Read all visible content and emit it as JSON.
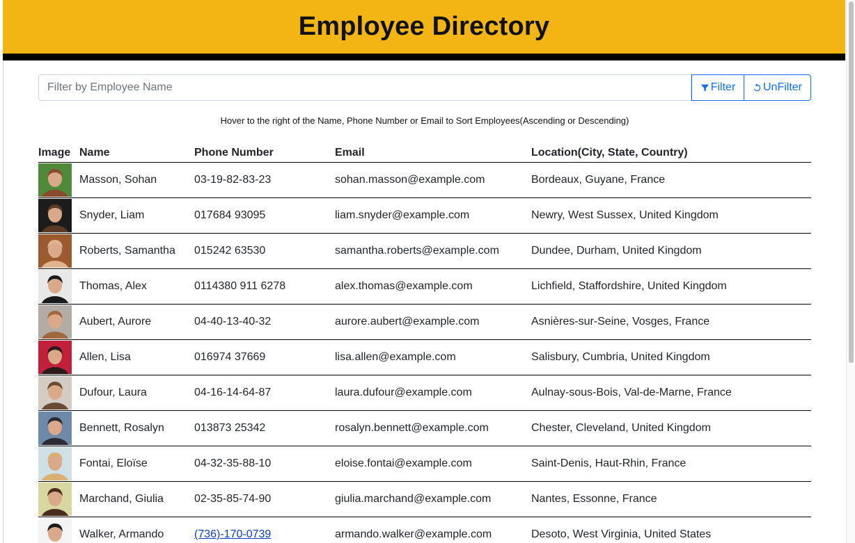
{
  "header": {
    "title": "Employee Directory"
  },
  "search": {
    "placeholder": "Filter by Employee Name",
    "filter_label": "Filter",
    "unfilter_label": "UnFilter"
  },
  "hint": "Hover to the right of the Name, Phone Number or Email to Sort Employees(Ascending or Descending)",
  "table": {
    "columns": [
      "Image",
      "Name",
      "Phone Number",
      "Email",
      "Location(City, State, Country)"
    ],
    "rows": [
      {
        "name": "Masson, Sohan",
        "phone": "03-19-82-83-23",
        "email": "sohan.masson@example.com",
        "location": "Bordeaux, Guyane, France",
        "avatar": [
          "#4e8a3a",
          "#8a4a2e"
        ]
      },
      {
        "name": "Snyder, Liam",
        "phone": "017684 93095",
        "email": "liam.snyder@example.com",
        "location": "Newry, West Sussex, United Kingdom",
        "avatar": [
          "#1c1c1c",
          "#5a3a24"
        ]
      },
      {
        "name": "Roberts, Samantha",
        "phone": "015242 63530",
        "email": "samantha.roberts@example.com",
        "location": "Dundee, Durham, United Kingdom",
        "avatar": [
          "#9c5a2f",
          "#e0b48f"
        ]
      },
      {
        "name": "Thomas, Alex",
        "phone": "0114380 911 6278",
        "email": "alex.thomas@example.com",
        "location": "Lichfield, Staffordshire, United Kingdom",
        "avatar": [
          "#e8e8e8",
          "#1a1a1a"
        ]
      },
      {
        "name": "Aubert, Aurore",
        "phone": "04-40-13-40-32",
        "email": "aurore.aubert@example.com",
        "location": "Asnières-sur-Seine, Vosges, France",
        "avatar": [
          "#b3aca6",
          "#a0683f"
        ]
      },
      {
        "name": "Allen, Lisa",
        "phone": "016974 37669",
        "email": "lisa.allen@example.com",
        "location": "Salisbury, Cumbria, United Kingdom",
        "avatar": [
          "#c21f3a",
          "#2a1a1a"
        ]
      },
      {
        "name": "Dufour, Laura",
        "phone": "04-16-14-64-87",
        "email": "laura.dufour@example.com",
        "location": "Aulnay-sous-Bois, Val-de-Marne, France",
        "avatar": [
          "#d4ccc4",
          "#6b4a33"
        ]
      },
      {
        "name": "Bennett, Rosalyn",
        "phone": "013873 25342",
        "email": "rosalyn.bennett@example.com",
        "location": "Chester, Cleveland, United Kingdom",
        "avatar": [
          "#6f8aa8",
          "#2b2b33"
        ]
      },
      {
        "name": "Fontai, Eloïse",
        "phone": "04-32-35-88-10",
        "email": "eloise.fontai@example.com",
        "location": "Saint-Denis, Haut-Rhin, France",
        "avatar": [
          "#cfe0e6",
          "#d9b070"
        ]
      },
      {
        "name": "Marchand, Giulia",
        "phone": "02-35-85-74-90",
        "email": "giulia.marchand@example.com",
        "location": "Nantes, Essonne, France",
        "avatar": [
          "#d8d7a0",
          "#4a2c1c"
        ]
      },
      {
        "name": "Walker, Armando",
        "phone": "(736)-170-0739",
        "email": "armando.walker@example.com",
        "location": "Desoto, West Virginia, United States",
        "avatar": [
          "#f4f4f4",
          "#1a1a1a"
        ],
        "phone_is_link": true
      }
    ]
  },
  "colors": {
    "header_bg": "#f3b514",
    "accent": "#0d6efd",
    "link": "#0d3bcc"
  },
  "icons": {
    "filter": "funnel-icon",
    "unfilter": "rotate-ccw-icon"
  }
}
